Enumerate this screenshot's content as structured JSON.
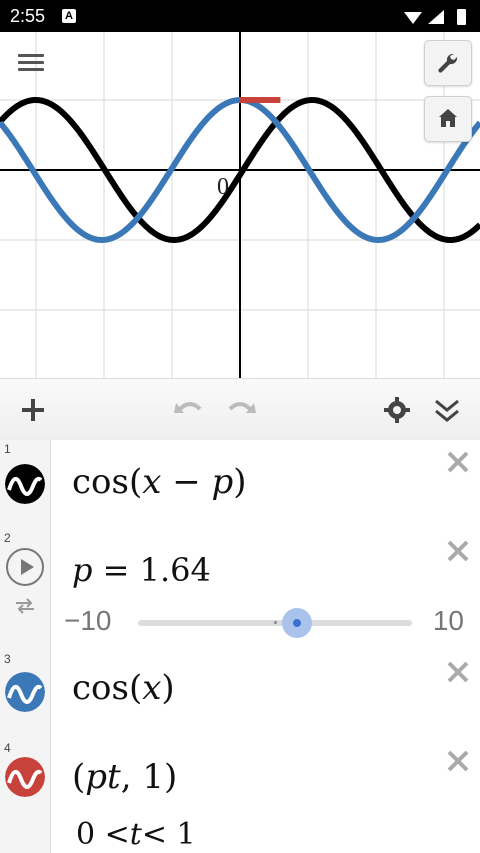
{
  "status_bar": {
    "time": "2:55",
    "notification_icon": "A"
  },
  "graph": {
    "origin_label": "0",
    "curves": [
      {
        "name": "cos(x-p)",
        "color": "#000000"
      },
      {
        "name": "cos(x)",
        "color": "#3b78b8"
      },
      {
        "name": "segment",
        "color": "#c8423c"
      }
    ]
  },
  "toolbar": {
    "add_icon": "plus-icon",
    "undo_icon": "undo-icon",
    "redo_icon": "redo-icon",
    "settings_icon": "gear-icon",
    "collapse_icon": "chevrons-down-icon"
  },
  "expressions": [
    {
      "index": "1",
      "color": "#000000",
      "latex_parts": {
        "func": "cos",
        "open": "(",
        "var": "x",
        "op": " − ",
        "param": "p",
        "close": ")"
      }
    },
    {
      "index": "2",
      "lhs": "p",
      "eq": " = ",
      "value": "1.64",
      "slider": {
        "min": "−10",
        "max": "10",
        "current": 1.64
      }
    },
    {
      "index": "3",
      "color": "#3b78b8",
      "latex_parts": {
        "func": "cos",
        "open": "(",
        "var": "x",
        "close": ")"
      }
    },
    {
      "index": "4",
      "color": "#c8423c",
      "point": {
        "open": "(",
        "a": "pt",
        "sep": ", ",
        "b": "1",
        "close": ")"
      },
      "domain": {
        "lo": "0",
        "lt1": "  <",
        "var": "t",
        "lt2": "<  ",
        "hi": "1"
      }
    }
  ]
}
